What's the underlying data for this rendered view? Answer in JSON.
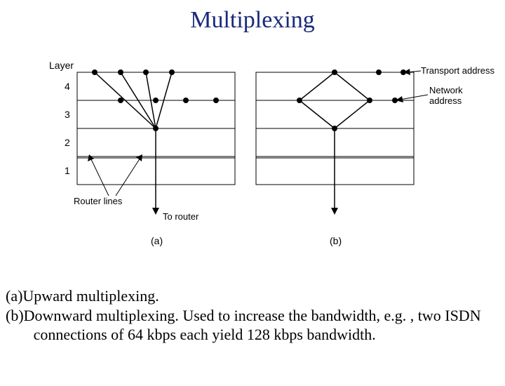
{
  "title": "Multiplexing",
  "figure": {
    "layer_label": "Layer",
    "layers": [
      "4",
      "3",
      "2",
      "1"
    ],
    "router_lines_label": "Router lines",
    "to_router_label": "To router",
    "transport_address_label": "Transport address",
    "network_address_label": "Network address",
    "sub_a": "(a)",
    "sub_b": "(b)"
  },
  "caption": {
    "line1": "(a)Upward multiplexing.",
    "line2": "(b)Downward multiplexing.  Used to increase the bandwidth, e.g. , two ISDN connections of 64 kbps each yield 128 kbps bandwidth."
  }
}
